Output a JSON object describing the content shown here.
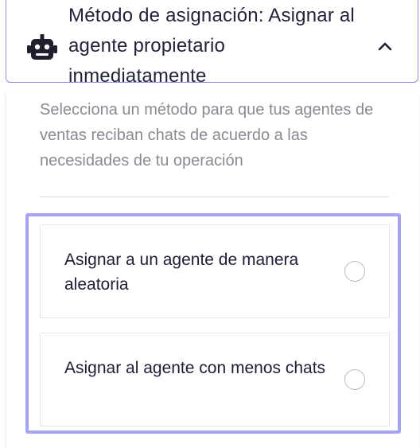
{
  "dropdown": {
    "title": "Método de asignación: Asignar al agente propietario inmediatamente",
    "bot_icon": "robot-icon",
    "chevron_icon": "chevron-up-icon"
  },
  "panel": {
    "description": "Selecciona un método para que tus agentes de ventas reciban chats de acuerdo a las necesidades de tu operación",
    "options": [
      {
        "label": "Asignar a un agente de manera aleatoria",
        "selected": false
      },
      {
        "label": "Asignar al agente con menos chats",
        "selected": false
      }
    ]
  },
  "colors": {
    "accent_border": "#a5a3f4",
    "header_border": "#8f8be6",
    "text_primary": "#1d1d35",
    "text_muted": "#8a8a92"
  }
}
